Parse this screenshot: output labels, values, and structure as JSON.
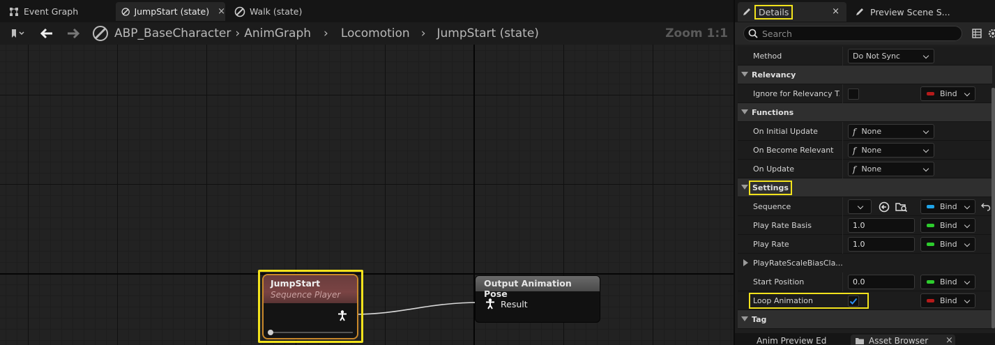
{
  "graph": {
    "tabs": [
      {
        "label": "Event Graph",
        "icon": "event-graph-icon"
      },
      {
        "label": "JumpStart (state)",
        "icon": "state-icon",
        "close": "×"
      },
      {
        "label": "Walk (state)",
        "icon": "state-icon"
      }
    ],
    "breadcrumb": [
      "ABP_BaseCharacter",
      "AnimGraph",
      "Locomotion",
      "JumpStart (state)"
    ],
    "zoom": "Zoom 1:1",
    "nodes": {
      "sequence_player": {
        "title": "JumpStart",
        "subtitle": "Sequence Player"
      },
      "output_pose": {
        "title": "Output Animation Pose",
        "pin_label": "Result"
      }
    }
  },
  "details": {
    "tab_label": "Details",
    "tab_close": "×",
    "preview_tab_label": "Preview Scene S...",
    "search_placeholder": "Search",
    "bind_label": "Bind",
    "rows": {
      "method": {
        "label": "Method",
        "value": "Do Not Sync"
      },
      "relevancy": {
        "label": "Relevancy"
      },
      "ignore_relevancy": {
        "label": "Ignore for Relevancy T..."
      },
      "functions": {
        "label": "Functions"
      },
      "on_initial_update": {
        "label": "On Initial Update",
        "value": "None"
      },
      "on_become_relevant": {
        "label": "On Become Relevant",
        "value": "None"
      },
      "on_update": {
        "label": "On Update",
        "value": "None"
      },
      "settings": {
        "label": "Settings"
      },
      "sequence": {
        "label": "Sequence"
      },
      "play_rate_basis": {
        "label": "Play Rate Basis",
        "value": "1.0"
      },
      "play_rate": {
        "label": "Play Rate",
        "value": "1.0"
      },
      "play_rate_scale_bias": {
        "label": "PlayRateScaleBiasCla..."
      },
      "start_position": {
        "label": "Start Position",
        "value": "0.0"
      },
      "loop_animation": {
        "label": "Loop Animation",
        "checked": true
      },
      "tag": {
        "label": "Tag"
      }
    },
    "bottom_tabs": [
      "Anim Preview Ed",
      "Asset Browser"
    ],
    "bottom_close": "×"
  },
  "colors": {
    "highlight": "#f2e21c",
    "bind_red": "#b51a1a",
    "bind_green": "#2dcc2d",
    "bind_blue": "#1fa4e8",
    "check_blue": "#2a8ff0"
  }
}
